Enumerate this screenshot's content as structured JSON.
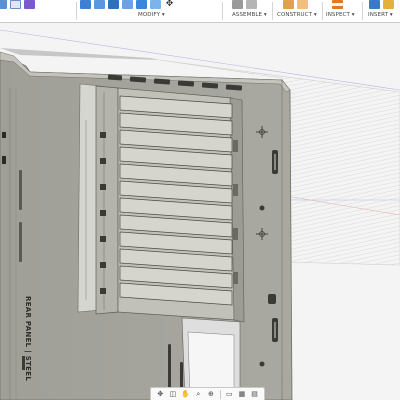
{
  "toolbar": {
    "groups": [
      {
        "label": "MODIFY ▾"
      },
      {
        "label": "ASSEMBLE ▾"
      },
      {
        "label": "CONSTRUCT ▾"
      },
      {
        "label": "INSPECT ▾"
      },
      {
        "label": "INSERT ▾"
      }
    ]
  },
  "model": {
    "engraved_text": "REAR PANEL | STEEL"
  },
  "navbar": {
    "icons": [
      "move-icon",
      "look-at-icon",
      "pan-icon",
      "zoom-icon",
      "fit-icon",
      "display-settings-icon",
      "grid-icon",
      "viewports-icon"
    ]
  },
  "colors": {
    "ribbon_bg": "#ffffff",
    "panel_gray": "#a8a8a0",
    "accent_blue": "#2f7bd3",
    "accent_orange": "#e07a1f"
  }
}
